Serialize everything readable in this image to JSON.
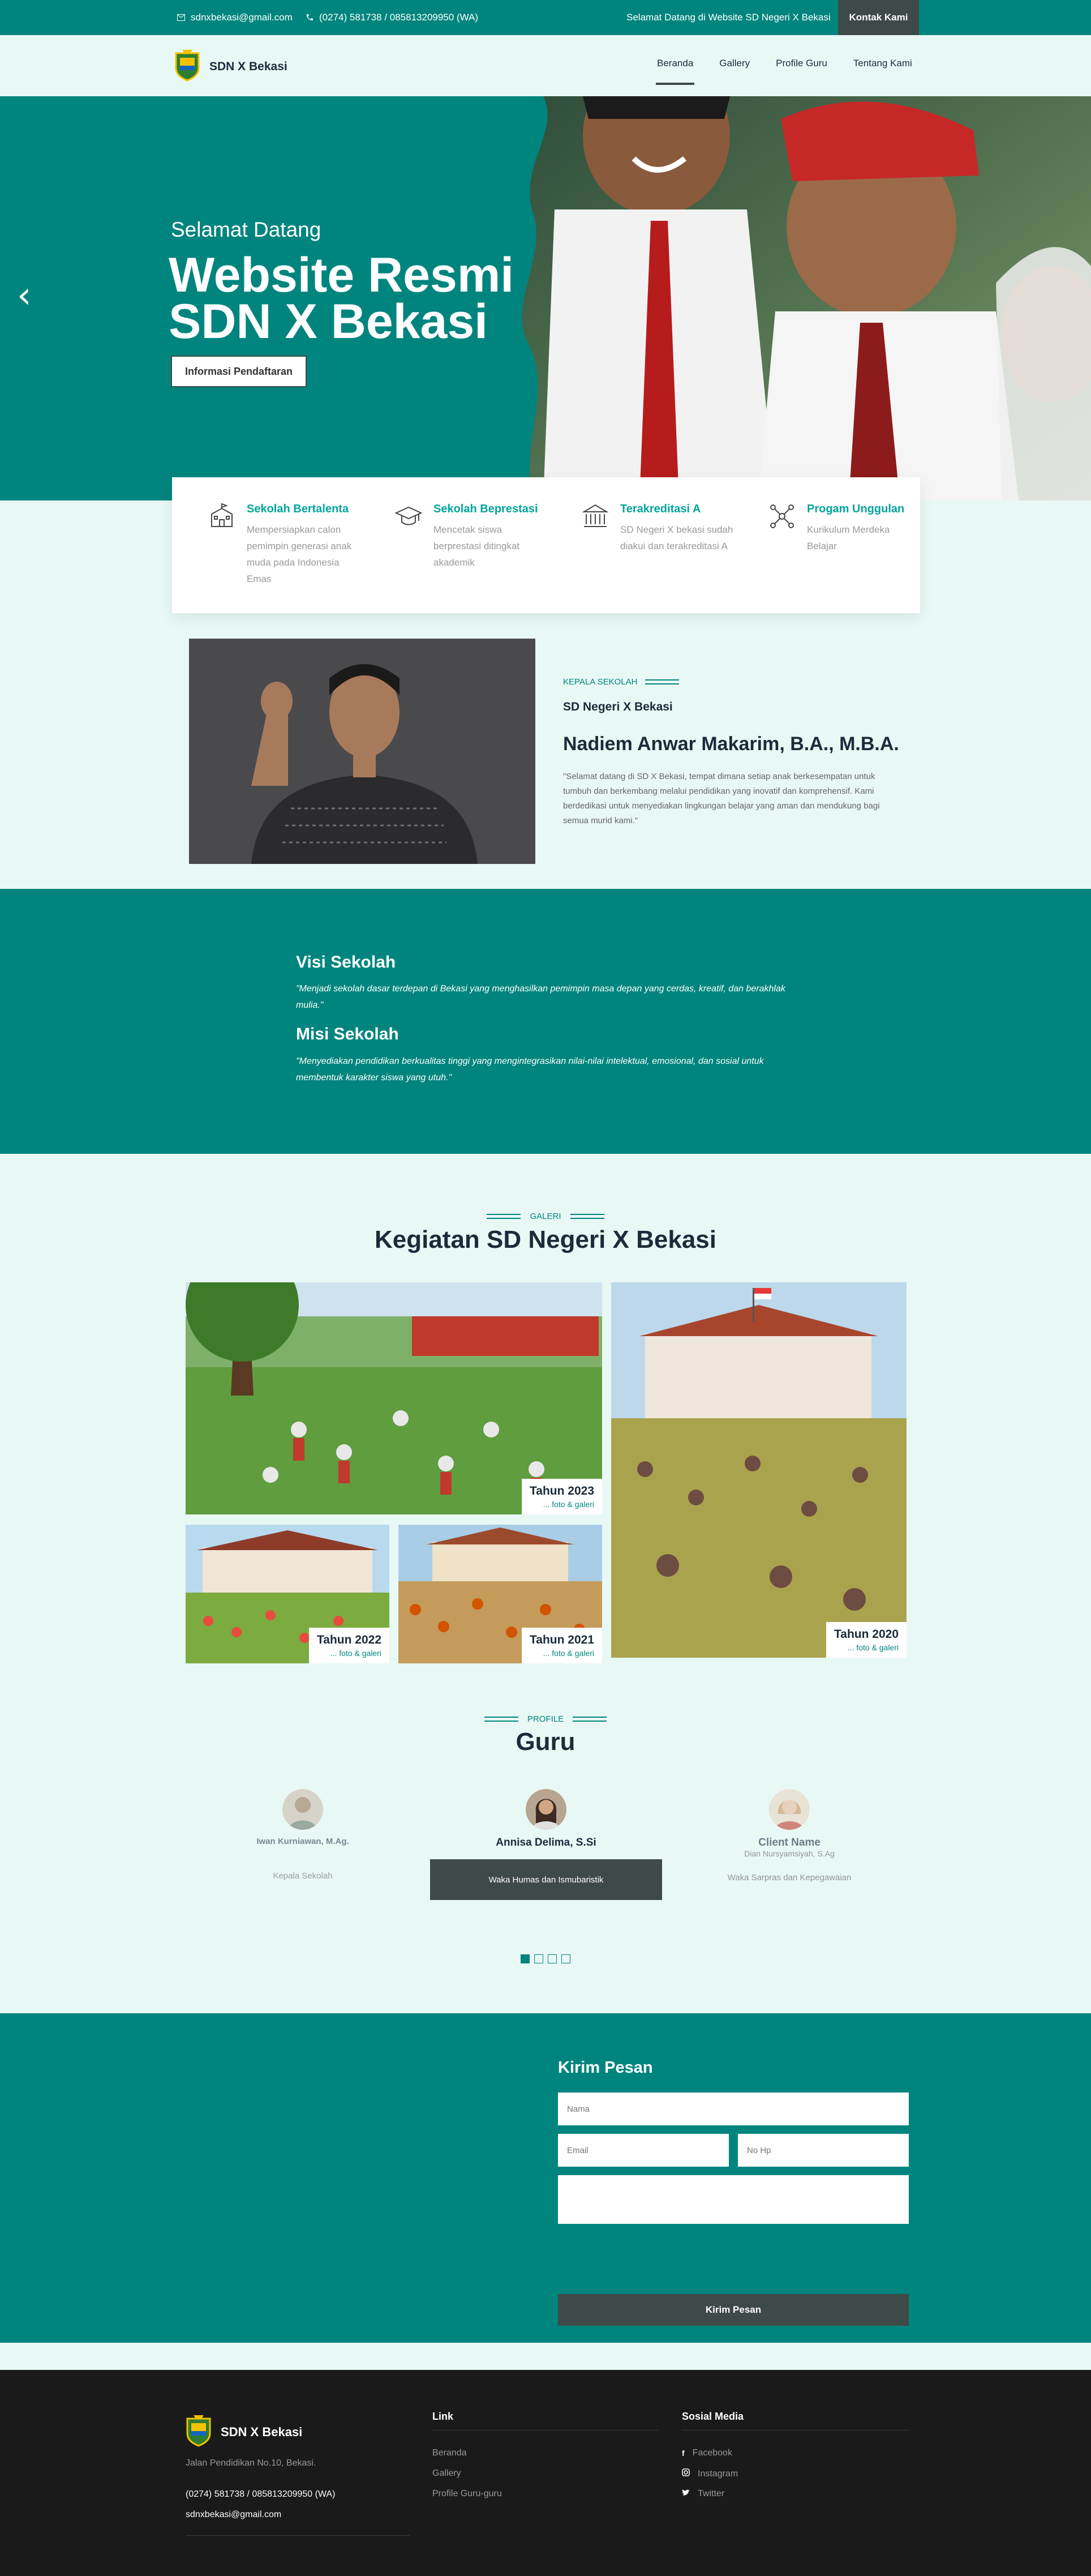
{
  "topbar": {
    "email": "sdnxbekasi@gmail.com",
    "phone": "(0274) 581738 / 085813209950 (WA)",
    "welcome": "Selamat Datang di Website SD Negeri X Bekasi",
    "contact_btn": "Kontak Kami"
  },
  "nav": {
    "brand": "SDN X Bekasi",
    "items": [
      "Beranda",
      "Gallery",
      "Profile Guru",
      "Tentang Kami"
    ]
  },
  "hero": {
    "welcome": "Selamat Datang",
    "title_line1": "Website Resmi",
    "title_line2": "SDN X Bekasi",
    "button": "Informasi Pendaftaran"
  },
  "features": [
    {
      "title": "Sekolah Bertalenta",
      "desc": "Mempersiapkan calon pemimpin generasi anak muda pada Indonesia Emas",
      "icon": "school-icon"
    },
    {
      "title": "Sekolah Beprestasi",
      "desc": "Mencetak siswa berprestasi ditingkat akademik",
      "icon": "graduation-cap-icon"
    },
    {
      "title": "Terakreditasi A",
      "desc": "SD Negeri X bekasi sudah diakui dan terakreditasi A",
      "icon": "institution-icon"
    },
    {
      "title": "Progam Unggulan",
      "desc": "Kurikulum Merdeka Belajar",
      "icon": "network-icon"
    }
  ],
  "principal": {
    "tag": "KEPALA SEKOLAH",
    "school": "SD Negeri X Bekasi",
    "name": "Nadiem Anwar Makarim, B.A., M.B.A.",
    "quote": "\"Selamat datang di SD X Bekasi, tempat dimana setiap anak berkesempatan untuk tumbuh dan berkembang melalui pendidikan yang inovatif dan komprehensif. Kami berdedikasi untuk menyediakan lingkungan belajar yang aman dan mendukung bagi semua murid kami.\""
  },
  "visi_misi": {
    "visi_title": "Visi Sekolah",
    "visi_text": "\"Menjadi sekolah dasar terdepan di Bekasi yang menghasilkan pemimpin masa depan yang cerdas, kreatif, dan berakhlak mulia.\"",
    "misi_title": "Misi Sekolah",
    "misi_text": "\"Menyediakan pendidikan berkualitas tinggi yang mengintegrasikan nilai-nilai intelektual, emosional, dan sosial untuk membentuk karakter siswa yang utuh.\""
  },
  "gallery": {
    "tag": "GALERI",
    "title": "Kegiatan SD Negeri X Bekasi",
    "items": [
      {
        "year": "Tahun 2023",
        "sub": "... foto & galeri"
      },
      {
        "year": "Tahun 2022",
        "sub": "... foto & galeri"
      },
      {
        "year": "Tahun 2021",
        "sub": "... foto & galeri"
      },
      {
        "year": "Tahun 2020",
        "sub": "... foto & galeri"
      }
    ]
  },
  "guru": {
    "tag": "PROFILE",
    "title": "Guru",
    "cards": [
      {
        "name": "Iwan Kurniawan, M.Ag.",
        "role": "Kepala Sekolah"
      },
      {
        "name": "Annisa Delima, S.Si",
        "role": "Waka Humas dan Ismubaristik"
      },
      {
        "name": "Client Name",
        "subname": "Dian Nursyamsiyah, S.Ag",
        "role": "Waka Sarpras dan Kepegawaian"
      }
    ]
  },
  "contact": {
    "title": "Kirim Pesan",
    "name_placeholder": "Nama",
    "email_placeholder": "Email",
    "phone_placeholder": "No Hp",
    "button": "Kirim Pesan"
  },
  "footer": {
    "brand": "SDN X Bekasi",
    "address": "Jalan Pendidikan No.10, Bekasi.",
    "phone": "(0274) 581738 / 085813209950 (WA)",
    "email": "sdnxbekasi@gmail.com",
    "link_head": "Link",
    "links": [
      "Beranda",
      "Gallery",
      "Profile Guru-guru"
    ],
    "social_head": "Sosial Media",
    "socials": [
      {
        "label": "Facebook",
        "icon": "facebook-icon"
      },
      {
        "label": "Instagram",
        "icon": "instagram-icon"
      },
      {
        "label": "Twitter",
        "icon": "twitter-icon"
      }
    ]
  },
  "colors": {
    "primary": "#00857e",
    "accent": "#00a59c",
    "dark": "#3e4a48",
    "background": "#e8f8f5",
    "footer": "#1a1a1a"
  }
}
